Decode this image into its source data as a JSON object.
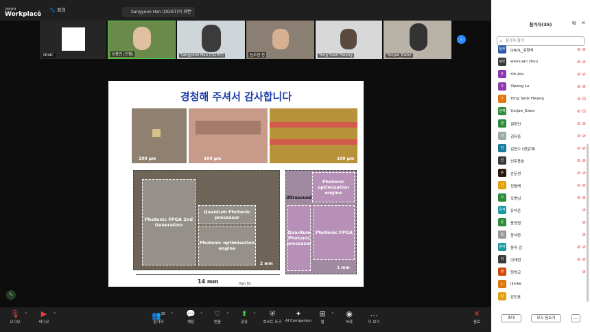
{
  "app": {
    "logo_top": "zoom",
    "logo_bottom": "Workplace",
    "meeting_label": "회의"
  },
  "share": {
    "label": "Sangyoon Han (DGIST)의 화면"
  },
  "header": {
    "view_label": "보기"
  },
  "gallery": {
    "tiles": [
      {
        "name": "ND4C",
        "bg": "#2b2b2b"
      },
      {
        "name": "이용진 (진행)",
        "bg": "#6a8a4a"
      },
      {
        "name": "Sangyoon Han (DGIST)",
        "bg": "#cfd6d9"
      },
      {
        "name": "신주현 전",
        "bg": "#8a7f72"
      },
      {
        "name": "Yong Seok Hwang",
        "bg": "#d8d8d8"
      },
      {
        "name": "Yunjae_Kwon",
        "bg": "#b9b2a7"
      }
    ]
  },
  "slide": {
    "title": "경청해 주셔서 감사합니다",
    "scale1": "100 µm",
    "scale2": "100 µm",
    "scale3": "100 µm",
    "fpga_label": "Photonic FPGA 2nd Generation",
    "qpp_label": "Quantum Photonic processor",
    "poe_label": "Photonic optimization engine",
    "mm2": "2 mm",
    "mm14": "14 mm",
    "cite": "Han 91",
    "r_poe": "Photonic optimization engine",
    "r_ultra": "Ultrasound",
    "r_qpp": "Quantum Photonic processor",
    "r_fpga": "Photonic FPGA",
    "r_scale": "1 mm"
  },
  "toolbar": {
    "items": [
      {
        "label": "오디오",
        "icon": "🎙"
      },
      {
        "label": "비디오",
        "icon": "▶"
      },
      {
        "label": "참가자",
        "icon": "👥",
        "count": "35"
      },
      {
        "label": "채팅",
        "icon": "💬"
      },
      {
        "label": "반응",
        "icon": "♡"
      },
      {
        "label": "공유",
        "icon": "⬆"
      },
      {
        "label": "호스트 도구",
        "icon": "⛨"
      },
      {
        "label": "AI Companion",
        "icon": "✦"
      },
      {
        "label": "앱",
        "icon": "⊞"
      },
      {
        "label": "녹화",
        "icon": "◉"
      },
      {
        "label": "더 보기",
        "icon": "…"
      },
      {
        "label": "종료",
        "icon": "✕"
      }
    ]
  },
  "panel": {
    "title": "참가자(35)",
    "search_placeholder": "참가자 찾기",
    "participants": [
      {
        "initials": "청주",
        "name": "QNDL_유향석",
        "color": "#2d5aa8",
        "icons": "⊘ ⊘"
      },
      {
        "initials": "WZ",
        "name": "wenxuan zhou",
        "color": "#3a3a3a",
        "icons": "⊘ ⊘"
      },
      {
        "initials": "X",
        "name": "xie zou",
        "color": "#8e3ab0",
        "icons": "⊘ ⊘"
      },
      {
        "initials": "X",
        "name": "Xipeng Lu",
        "color": "#8e3ab0",
        "icons": "⊘ ⊘"
      },
      {
        "initials": "Y",
        "name": "Yong Seok Hwang",
        "color": "#e07a10",
        "icons": "⊘ ⊡"
      },
      {
        "initials": "윤재",
        "name": "Yunjae_Kwon",
        "color": "#2e8b3a",
        "icons": "⊘ ⊡"
      },
      {
        "initials": "권",
        "name": "권하민",
        "color": "#2e8b3a",
        "icons": "⊘ ⊘"
      },
      {
        "initials": "김",
        "name": "김유중",
        "color": "#9aa",
        "icons": "⊘ ⊘"
      },
      {
        "initials": "김",
        "name": "김현수 (영운대)",
        "color": "#1a7a9a",
        "icons": "⊘ ⊘"
      },
      {
        "initials": "선",
        "name": "선우용호",
        "color": "#3a3a3a",
        "icons": "⊘ ⊘"
      },
      {
        "initials": "손",
        "name": "손문성",
        "color": "#2a1a10",
        "icons": "⊘ ⊘"
      },
      {
        "initials": "신",
        "name": "신형래",
        "color": "#e0a010",
        "icons": "⊘ ⊘"
      },
      {
        "initials": "오",
        "name": "오병님",
        "color": "#2e8b3a",
        "icons": "⊘ ⊘"
      },
      {
        "initials": "유석",
        "name": "유석준",
        "color": "#1a9aa0",
        "icons": "⊘"
      },
      {
        "initials": "윤",
        "name": "윤경원",
        "color": "#2e8b3a",
        "icons": "⊘"
      },
      {
        "initials": "윤",
        "name": "윤석환",
        "color": "#999",
        "icons": "⊘"
      },
      {
        "initials": "윤아",
        "name": "윤아 김",
        "color": "#1a9aa0",
        "icons": "⊘ ⊘"
      },
      {
        "initials": "이",
        "name": "이재현",
        "color": "#3a3a3a",
        "icons": "⊘ ⊘"
      },
      {
        "initials": "정",
        "name": "정영교",
        "color": "#d04a10",
        "icons": "⊘"
      },
      {
        "initials": "L",
        "name": "lijinke",
        "color": "#e07a10",
        "icons": ""
      },
      {
        "initials": "강",
        "name": "강진표",
        "color": "#e0a010",
        "icons": ""
      }
    ],
    "invite_label": "초대",
    "mute_all_label": "모두 음소거",
    "more_label": "…"
  }
}
